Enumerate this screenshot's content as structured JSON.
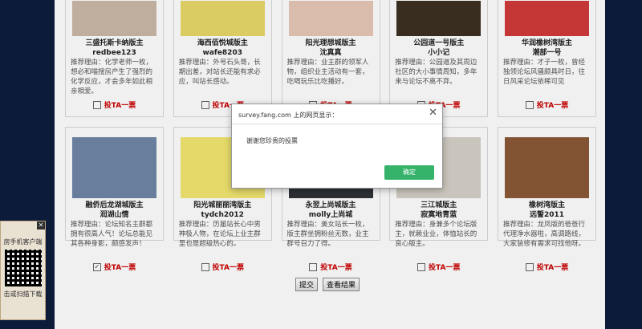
{
  "row1": [
    {
      "name": "三盛托斯卡纳版主",
      "user": "redbee123",
      "reason": "推荐理由：化学老师一枚，想必和喵搜房产生了强烈的化学反应，才会多年如此相亲相爱。",
      "vote": "投TA一票"
    },
    {
      "name": "海西佰悦城版主",
      "user": "wafe8203",
      "reason": "推荐理由：外号石头哥，长期出差，对站长还能有求必应，叫站长感动。",
      "vote": "投TA一票"
    },
    {
      "name": "阳光理想城版主",
      "user": "沈真真",
      "reason": "推荐理由：业主群的领军人物，组织业主活动有一套，吃喝玩乐比吃播好。",
      "vote": "投TA一票"
    },
    {
      "name": "公园道一号版主",
      "user": "小小记",
      "reason": "推荐理由：公园道及其周边社区的大小事情周知，多年来与论坛不离不弃。",
      "vote": "投TA一票"
    },
    {
      "name": "华润橡树湾版主",
      "user": "潮部一号",
      "reason": "推荐理由：才子一枚，曾经独领论坛风骚颇具时日，往日风采论坛依稀可见",
      "vote": "投TA一票"
    }
  ],
  "row2": [
    {
      "name": "融侨后龙湖城版主",
      "user": "润湖山情",
      "reason": "推荐理由：论坛知名主群都拥有很高人气！论坛总能见其各种身影，颇感发声！",
      "vote": "投TA一票",
      "checked": true
    },
    {
      "name": "阳光城丽丽湾版主",
      "user": "tydch2012",
      "reason": "推荐理由：历届站长心中男神极人物，在论坛上业主群里也是超级热心的。",
      "vote": "投TA一票",
      "checked": false
    },
    {
      "name": "永翌上尚城版主",
      "user": "molly上尚城",
      "reason": "推荐理由：美女站长一枚，版主群坐拥粉丝无数，业主群号召力了得。",
      "vote": "投TA一票",
      "checked": false
    },
    {
      "name": "三江城版主",
      "user": "寂寞地青蓝",
      "reason": "推荐理由：身兼多个论坛版主，就赖业业，体恤站长的良心版主。",
      "vote": "投TA一票",
      "checked": false
    },
    {
      "name": "橡树湾版主",
      "user": "远誓2011",
      "reason": "推荐理由：龙凤版的爸爸行代理净水器啦，高调路线，大家装修有需求可找他呀。",
      "vote": "投TA一票",
      "checked": false
    }
  ],
  "buttons": {
    "submit": "提交",
    "results": "查看结果"
  },
  "dialog": {
    "title": "survey.fang.com 上的网页显示：",
    "message": "谢谢您珍贵的投票",
    "ok": "确定",
    "close": "✕"
  },
  "qr": {
    "top": "房手机客户端",
    "bottom": "击或扫描下载",
    "close": "✕"
  }
}
